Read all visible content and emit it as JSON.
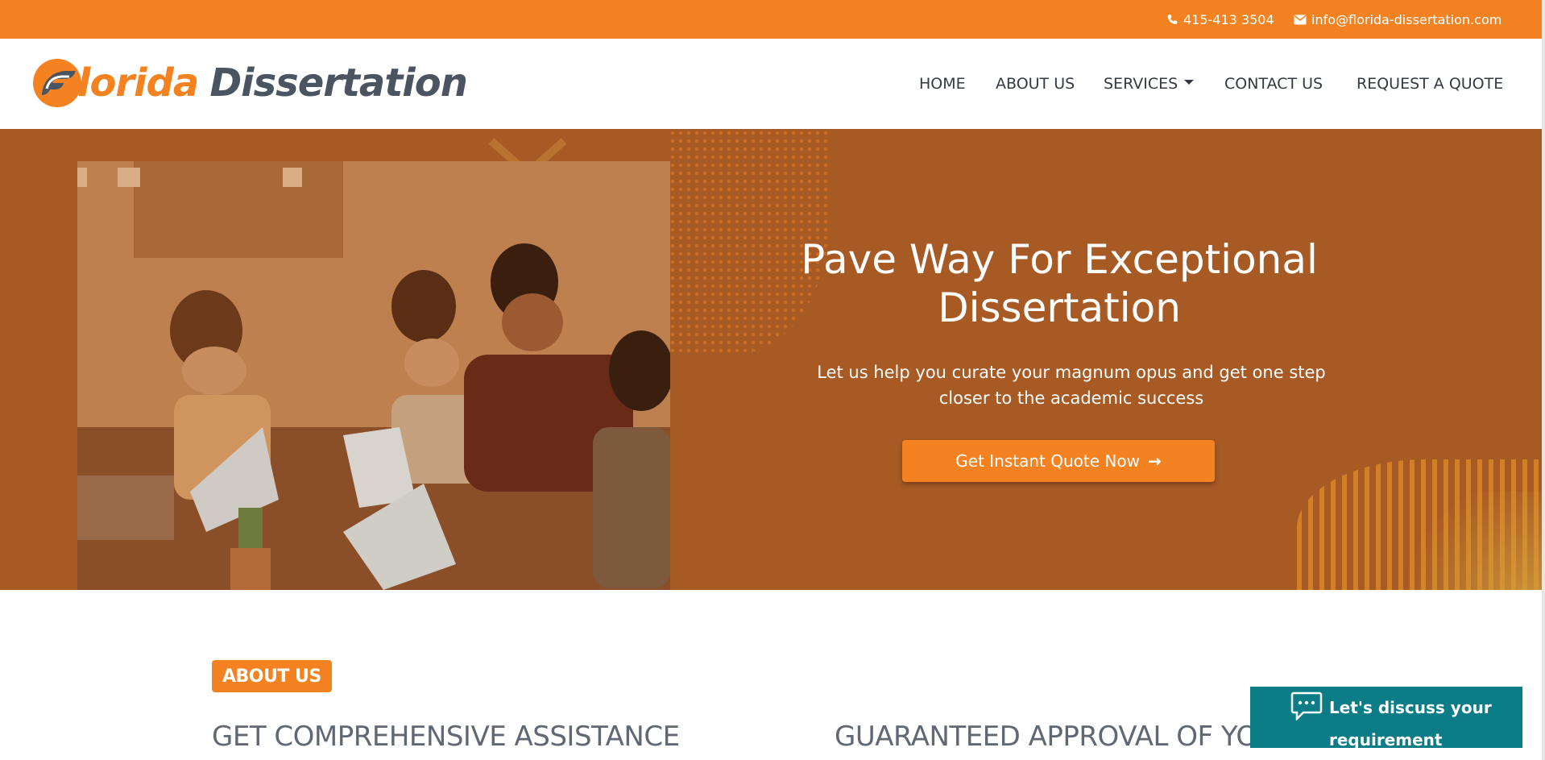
{
  "topbar": {
    "phone": "415-413 3504",
    "email": "info@florida-dissertation.com",
    "phone_icon": "phone-icon",
    "email_icon": "envelope-icon"
  },
  "brand": {
    "name_part1": "lorida",
    "name_part2": "Dissertation",
    "accent_color": "#f58220",
    "dark_color": "#4a5561"
  },
  "nav": {
    "items": [
      {
        "label": "HOME"
      },
      {
        "label": "ABOUT US"
      },
      {
        "label": "SERVICES",
        "has_dropdown": true
      },
      {
        "label": "CONTACT US"
      },
      {
        "label": "REQUEST A QUOTE"
      }
    ]
  },
  "hero": {
    "title": "Pave Way For Exceptional Dissertation",
    "subtitle": "Let us help you curate your magnum opus and get one step closer to the academic success",
    "cta_label": "Get Instant Quote Now",
    "cta_icon": "arrow-right-icon",
    "overlay_color": "#a85a24"
  },
  "about": {
    "badge": "ABOUT US",
    "heading_left": "GET COMPREHENSIVE ASSISTANCE",
    "heading_right": "GUARANTEED APPROVAL OF YOUR"
  },
  "chat": {
    "label": "Let's discuss your requirement",
    "icon": "chat-bubble-icon",
    "color": "#0c7c86"
  }
}
